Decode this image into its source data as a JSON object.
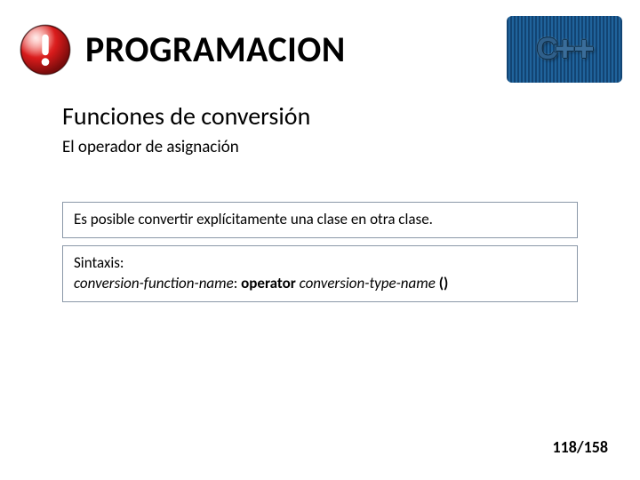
{
  "header": {
    "title": "PROGRAMACION",
    "warn_icon_name": "exclamation-icon",
    "logo_text_c": "C",
    "logo_text_plus": "++",
    "logo_name": "cpp-logo"
  },
  "content": {
    "subtitle": "Funciones de conversión",
    "subsubtitle": "El operador  de asignación"
  },
  "box1": {
    "text": "Es posible convertir explícitamente una clase en otra clase."
  },
  "box2": {
    "label": "Sintaxis:",
    "part1": "conversion-function-name",
    "colon1": ": ",
    "op": "operator",
    "space": " ",
    "part2": "conversion-type-name",
    "paren": " ()"
  },
  "pager": {
    "text": "118/158"
  }
}
